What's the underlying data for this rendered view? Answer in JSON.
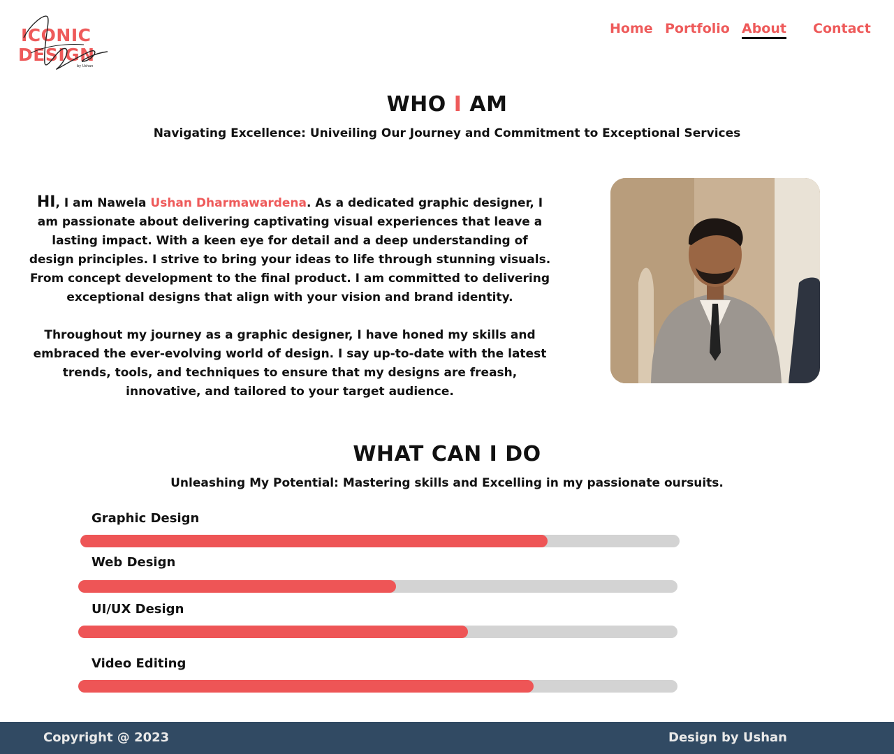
{
  "logo": {
    "line1": "ICONIC",
    "line2": "DESIGN",
    "signature": "by Ushan"
  },
  "nav": {
    "items": [
      {
        "label": "Home"
      },
      {
        "label": "Portfolio"
      },
      {
        "label": "About",
        "active": true
      },
      {
        "label": "Contact"
      }
    ]
  },
  "who": {
    "title_part1": "WHO ",
    "title_accent": "I",
    "title_part2": " AM",
    "subtitle": "Navigating Excellence: Univeiling Our Journey and Commitment to Exceptional Services"
  },
  "about": {
    "hi": "HI",
    "intro_prefix": ", I am Nawela ",
    "name": "Ushan Dharmawardena",
    "intro_rest": ". As a dedicated graphic designer, I am passionate about delivering captivating visual experiences that leave a lasting impact. With a keen eye for detail and a deep understanding of design principles. I strive to bring your ideas to life through stunning visuals. From concept development to the final product. I am committed to delivering exceptional designs that align with your vision and brand identity.",
    "paragraph2": "Throughout my journey as a graphic designer, I have honed my skills and embraced the ever-evolving world of design. I say up-to-date with the latest trends, tools, and techniques to ensure that my designs are freash, innovative, and tailored to your target audience."
  },
  "skills_section": {
    "title": "WHAT CAN I DO",
    "subtitle": "Unleashing My Potential: Mastering skills and Excelling in my passionate oursuits.",
    "skills": [
      {
        "label": "Graphic Design",
        "level": 0.78
      },
      {
        "label": "Web Design",
        "level": 0.53
      },
      {
        "label": "UI/UX Design",
        "level": 0.65
      },
      {
        "label": "Video Editing",
        "level": 0.76
      }
    ]
  },
  "footer": {
    "copyright": "Copyright @ 2023",
    "credit": "Design by Ushan"
  },
  "colors": {
    "accent": "#ee5a5a",
    "bar_fill": "#ee5556",
    "bar_track": "#d3d3d3",
    "footer_bg": "#314a63"
  }
}
